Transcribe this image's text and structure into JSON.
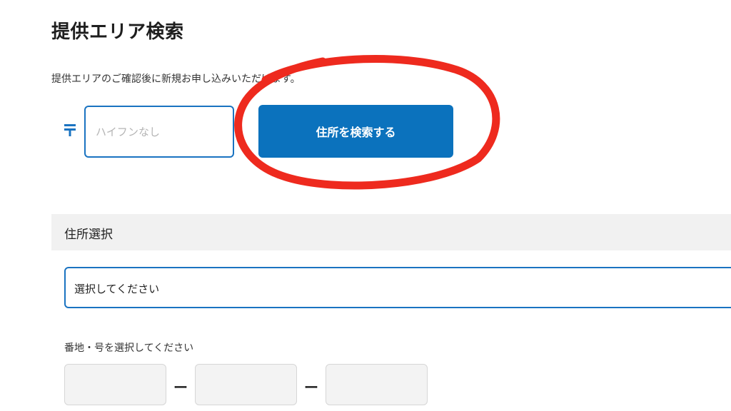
{
  "page": {
    "title": "提供エリア検索",
    "description": "提供エリアのご確認後に新規お申し込みいただけます。"
  },
  "postal": {
    "placeholder": "ハイフンなし",
    "search_button_label": "住所を検索する"
  },
  "address_section": {
    "title": "住所選択",
    "select_value": "選択してください"
  },
  "block_section": {
    "label": "番地・号を選択してください",
    "separator": "ー"
  },
  "colors": {
    "accent": "#0b72bd",
    "annotation": "#ee2a1e"
  },
  "icons": {
    "postal_mark": "postal-mark-icon"
  }
}
